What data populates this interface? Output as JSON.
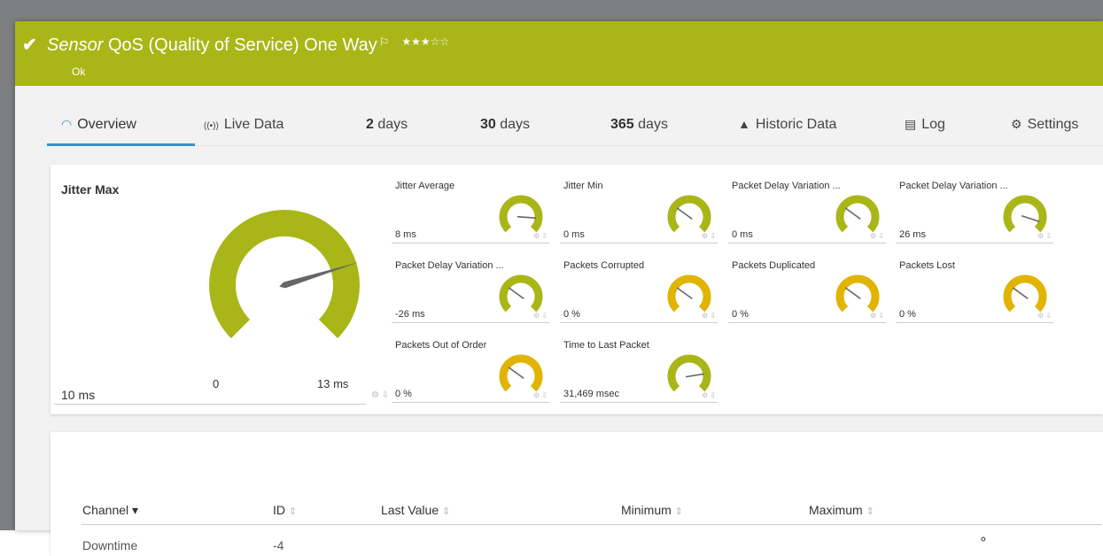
{
  "header": {
    "title_prefix": "Sensor",
    "title": "QoS (Quality of Service) One Way",
    "flag_icon": "⚐",
    "stars": "★★★☆☆",
    "status": "Ok",
    "check": "✔",
    "color": "#a9b617"
  },
  "tabs": [
    {
      "icon": "◠",
      "label": "Overview"
    },
    {
      "icon": "((•))",
      "label": "Live Data"
    },
    {
      "num": "2",
      "label": "days"
    },
    {
      "num": "30",
      "label": "days"
    },
    {
      "num": "365",
      "label": "days"
    },
    {
      "icon": "▲",
      "label": "Historic Data"
    },
    {
      "icon": "▤",
      "label": "Log"
    },
    {
      "icon": "⚙",
      "label": "Settings"
    }
  ],
  "big_gauge": {
    "title": "Jitter Max",
    "value": "10 ms",
    "min_label": "0",
    "max_label": "13 ms",
    "level": 0.77
  },
  "gauges": [
    {
      "title": "Jitter Average",
      "value": "8 ms",
      "color": "#a9b617",
      "level": 0.85
    },
    {
      "title": "Jitter Min",
      "value": "0 ms",
      "color": "#a9b617",
      "level": 0.3
    },
    {
      "title": "Packet Delay Variation ...",
      "value": "0 ms",
      "color": "#a9b617",
      "level": 0.3
    },
    {
      "title": "Packet Delay Variation ...",
      "value": "26 ms",
      "color": "#a9b617",
      "level": 0.9
    },
    {
      "title": "Packet Delay Variation ...",
      "value": "-26 ms",
      "color": "#a9b617",
      "level": 0.3
    },
    {
      "title": "Packets Corrupted",
      "value": "0 %",
      "color": "#e0b400",
      "level": 0.3
    },
    {
      "title": "Packets Duplicated",
      "value": "0 %",
      "color": "#e0b400",
      "level": 0.3
    },
    {
      "title": "Packets Lost",
      "value": "0 %",
      "color": "#e0b400",
      "level": 0.3
    },
    {
      "title": "Packets Out of Order",
      "value": "0 %",
      "color": "#e0b400",
      "level": 0.3
    },
    {
      "title": "Time to Last Packet",
      "value": "31,469 msec",
      "color": "#a9b617",
      "level": 0.8
    }
  ],
  "table": {
    "headers": {
      "channel": "Channel",
      "id": "ID",
      "last_value": "Last Value",
      "minimum": "Minimum",
      "maximum": "Maximum"
    },
    "sort_desc": "▾",
    "sort_both": "⇕",
    "rows": [
      {
        "channel": "Downtime",
        "id": "-4",
        "icon": "⚬"
      }
    ]
  },
  "gauge_controls": "⚙ ⇩"
}
